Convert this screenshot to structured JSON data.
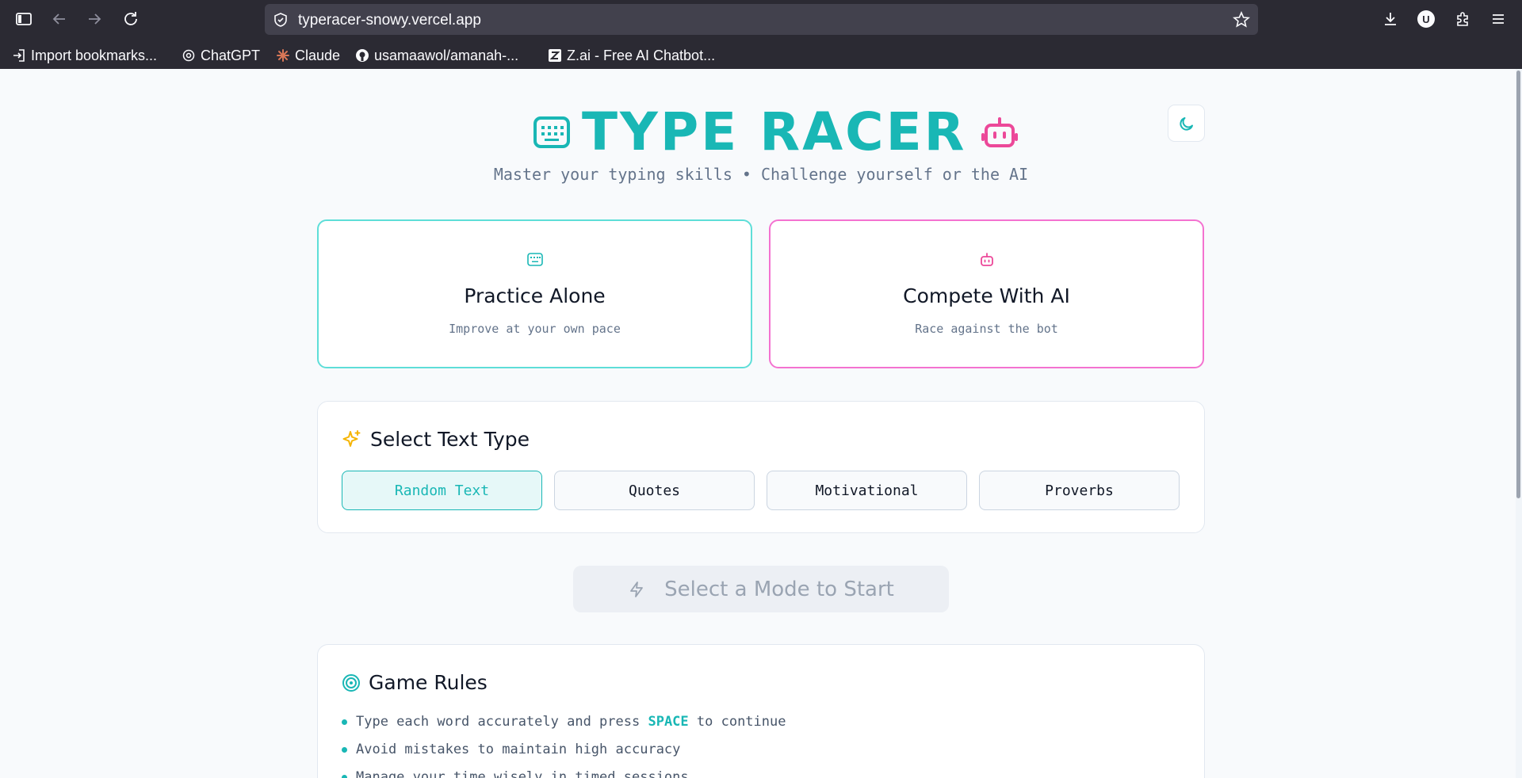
{
  "browser": {
    "url": "typeracer-snowy.vercel.app",
    "profile_initial": "U",
    "bookmarks": [
      {
        "label": "Import bookmarks...",
        "icon": "import-icon"
      },
      {
        "label": "ChatGPT",
        "icon": "chatgpt-icon"
      },
      {
        "label": "Claude",
        "icon": "claude-icon"
      },
      {
        "label": "usamaawol/amanah-...",
        "icon": "github-icon"
      },
      {
        "label": "Z.ai - Free AI Chatbot...",
        "icon": "zai-icon"
      }
    ]
  },
  "header": {
    "title": "TYPE RACER",
    "subtitle": "Master your typing skills • Challenge yourself or the AI",
    "left_icon": "keyboard-icon",
    "right_icon": "robot-icon",
    "theme_toggle_icon": "moon-icon"
  },
  "modes": [
    {
      "title": "Practice Alone",
      "description": "Improve at your own pace",
      "icon": "keyboard-icon",
      "accent": "#19b7b5"
    },
    {
      "title": "Compete With AI",
      "description": "Race against the bot",
      "icon": "robot-icon",
      "accent": "#ec4899"
    }
  ],
  "text_type": {
    "heading": "Select Text Type",
    "icon": "sparkles-icon",
    "options": [
      "Random Text",
      "Quotes",
      "Motivational",
      "Proverbs"
    ],
    "selected": "Random Text"
  },
  "start": {
    "label": "Select a Mode to Start",
    "icon": "lightning-icon"
  },
  "rules": {
    "heading": "Game Rules",
    "icon": "target-icon",
    "items": [
      {
        "before": "Type each word accurately and press ",
        "key": "SPACE",
        "after": " to continue"
      },
      {
        "before": "Avoid mistakes to maintain high accuracy",
        "key": "",
        "after": ""
      },
      {
        "before": "Manage your time wisely in timed sessions",
        "key": "",
        "after": ""
      }
    ]
  },
  "colors": {
    "primary": "#19b7b5",
    "secondary": "#ec4899",
    "background": "#f8fafc"
  }
}
